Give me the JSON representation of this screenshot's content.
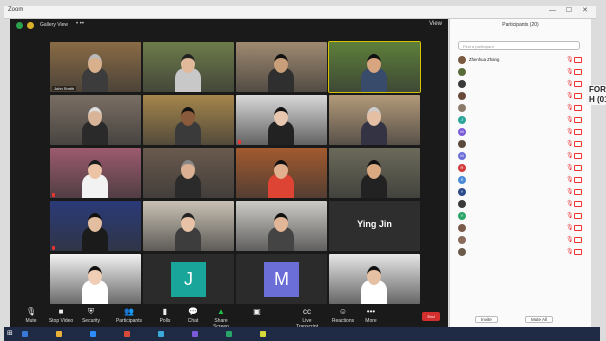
{
  "window": {
    "title": "Zoom",
    "controls": "—  ☐  ✕"
  },
  "meeting": {
    "view_label": "Gallery View",
    "view_button": "View",
    "dots": "•  ••"
  },
  "tiles": [
    {
      "name": "John Smith",
      "bg": "#8a6b45",
      "skin": "#d9b08c",
      "shirt": "#3c3c3c",
      "hair": "#bbb",
      "sel": false,
      "mic": false
    },
    {
      "name": "",
      "bg": "#6d7b4a",
      "skin": "#e2b99a",
      "shirt": "#c8c8c8",
      "hair": "#222",
      "sel": false,
      "mic": false
    },
    {
      "name": "",
      "bg": "#9f8a70",
      "skin": "#c99f7a",
      "shirt": "#2f2f2f",
      "hair": "#111",
      "sel": false,
      "mic": false
    },
    {
      "name": "",
      "bg": "#5d7f3a",
      "skin": "#d7a57f",
      "shirt": "#394b6b",
      "hair": "#111",
      "sel": true,
      "mic": false
    },
    {
      "name": "",
      "bg": "#7a6e63",
      "skin": "#d8b599",
      "shirt": "#2a2a2a",
      "hair": "#ddd",
      "sel": false,
      "mic": false
    },
    {
      "name": "",
      "bg": "#a5864c",
      "skin": "#8a5a3c",
      "shirt": "#3a3a3a",
      "hair": "#111",
      "sel": false,
      "mic": false
    },
    {
      "name": "",
      "bg": "#d8d8d8",
      "skin": "#e8c7b0",
      "shirt": "#222",
      "hair": "#111",
      "sel": false,
      "mic": true
    },
    {
      "name": "",
      "bg": "#b39a7a",
      "skin": "#e4bfa4",
      "shirt": "#334",
      "hair": "#ccc",
      "sel": false,
      "mic": false
    },
    {
      "name": "",
      "bg": "#9c5a6e",
      "skin": "#ecc3a5",
      "shirt": "#f2f2f2",
      "hair": "#1a1a1a",
      "sel": false,
      "mic": true
    },
    {
      "name": "",
      "bg": "#6a5a4e",
      "skin": "#dcb193",
      "shirt": "#2b2b2b",
      "hair": "#888",
      "sel": false,
      "mic": false
    },
    {
      "name": "",
      "bg": "#a35a2f",
      "skin": "#e0b08f",
      "shirt": "#d43",
      "hair": "#111",
      "sel": false,
      "mic": false
    },
    {
      "name": "",
      "bg": "#6b6a5a",
      "skin": "#d9a982",
      "shirt": "#222",
      "hair": "#111",
      "sel": false,
      "mic": false
    },
    {
      "name": "",
      "bg": "#2a3a78",
      "skin": "#e3bd9f",
      "shirt": "#1b1b1b",
      "hair": "#111",
      "sel": false,
      "mic": true
    },
    {
      "name": "",
      "bg": "#c9c1b4",
      "skin": "#e7c2a6",
      "shirt": "#3d3d3d",
      "hair": "#222",
      "sel": false,
      "mic": false
    },
    {
      "name": "",
      "bg": "#cdcbc6",
      "skin": "#e1b798",
      "shirt": "#444",
      "hair": "#111",
      "sel": false,
      "mic": false
    },
    {
      "name": "Ying Jin",
      "bg": "#2e2e2e",
      "kind": "name_only",
      "sel": false,
      "mic": false
    },
    {
      "name": "",
      "bg": "#f2f2f2",
      "skin": "#f0cdb5",
      "shirt": "#fff",
      "hair": "#111",
      "sel": false,
      "mic": false
    },
    {
      "name": "",
      "kind": "letter",
      "letter": "J",
      "color": "#1aa59a",
      "sel": false,
      "mic": false
    },
    {
      "name": "",
      "kind": "letter",
      "letter": "M",
      "color": "#6c6ed8",
      "sel": false,
      "mic": false
    },
    {
      "name": "",
      "bg": "#e6e6e6",
      "skin": "#e6c0a2",
      "shirt": "#fff",
      "hair": "#111",
      "sel": false,
      "mic": false
    }
  ],
  "toolbar": [
    {
      "label": "Mute",
      "icon": "🎙",
      "tone": ""
    },
    {
      "label": "Stop Video",
      "icon": "■",
      "tone": ""
    },
    {
      "label": "Security",
      "icon": "⛨",
      "tone": ""
    },
    {
      "label": "Participants",
      "icon": "👥",
      "tone": ""
    },
    {
      "label": "Polls",
      "icon": "▮",
      "tone": ""
    },
    {
      "label": "Chat",
      "icon": "💬",
      "tone": ""
    },
    {
      "label": "Share Screen",
      "icon": "▲",
      "tone": "green"
    },
    {
      "label": "",
      "icon": "▣",
      "tone": ""
    },
    {
      "label": "Live Transcript",
      "icon": "cc",
      "tone": ""
    },
    {
      "label": "Reactions",
      "icon": "☺",
      "tone": ""
    },
    {
      "label": "More",
      "icon": "•••",
      "tone": ""
    }
  ],
  "end_label": "End",
  "participants_panel": {
    "title": "Participants (20)",
    "search_placeholder": "Find a participant",
    "items": [
      {
        "name": "Zhenhua Zhang",
        "av": "#7a5a40",
        "letter": ""
      },
      {
        "name": "",
        "av": "#5a6b3a",
        "letter": ""
      },
      {
        "name": "",
        "av": "#3a3a3a",
        "letter": ""
      },
      {
        "name": "",
        "av": "#6a4a3a",
        "letter": ""
      },
      {
        "name": "",
        "av": "#8a7a6a",
        "letter": ""
      },
      {
        "name": "",
        "av": "#2aa59a",
        "letter": "J"
      },
      {
        "name": "",
        "av": "#7a5ad8",
        "letter": "M"
      },
      {
        "name": "",
        "av": "#5a4a3a",
        "letter": ""
      },
      {
        "name": "",
        "av": "#6a6ed8",
        "letter": "M"
      },
      {
        "name": "",
        "av": "#d43a3a",
        "letter": "R"
      },
      {
        "name": "",
        "av": "#4a8ad8",
        "letter": "S"
      },
      {
        "name": "",
        "av": "#2a4a8a",
        "letter": "Y"
      },
      {
        "name": "",
        "av": "#3a3a3a",
        "letter": ""
      },
      {
        "name": "",
        "av": "#2aa56a",
        "letter": "Y"
      },
      {
        "name": "",
        "av": "#7a5a4a",
        "letter": ""
      },
      {
        "name": "",
        "av": "#8a6a5a",
        "letter": ""
      },
      {
        "name": "",
        "av": "#6a5a4a",
        "letter": ""
      }
    ],
    "host_note": "",
    "invite_label": "Invite",
    "mute_all_label": "Mute All"
  },
  "side_text": [
    "FOR",
    "H (016"
  ],
  "taskbar": {
    "items": [
      {
        "label": "",
        "color": "#3a78d8"
      },
      {
        "label": "",
        "color": "#e8b23a"
      },
      {
        "label": "",
        "color": "#2d8cff"
      },
      {
        "label": "",
        "color": "#d84a3a"
      },
      {
        "label": "",
        "color": "#3aa8d8"
      },
      {
        "label": "",
        "color": "#7a5ad8"
      },
      {
        "label": "",
        "color": "#2aa56a"
      },
      {
        "label": "",
        "color": "#d8d83a"
      }
    ],
    "tray": ""
  }
}
